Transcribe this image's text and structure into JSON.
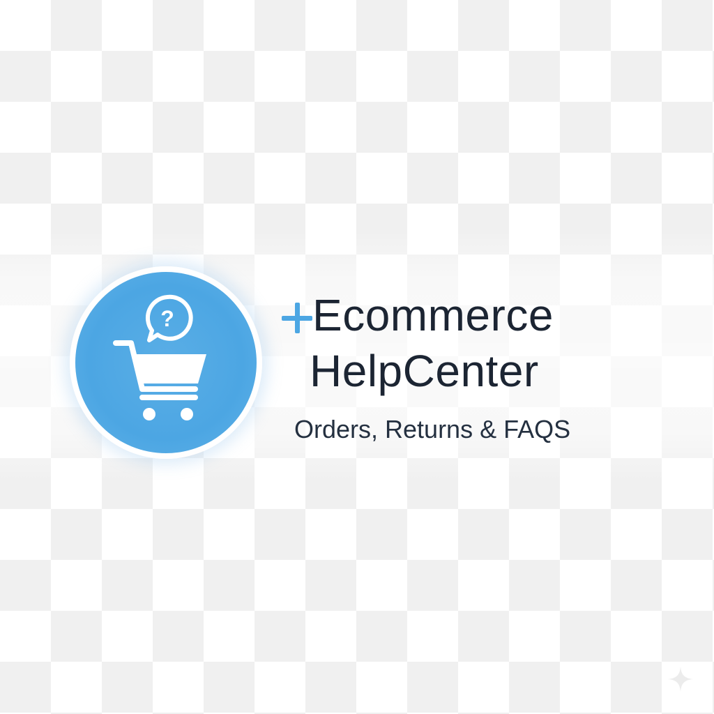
{
  "logo": {
    "icon": "shopping-cart-question-icon",
    "circle_color": "#4ca6e3"
  },
  "brand": {
    "plus_icon": "plus-icon",
    "title_line_1": "Ecommerce",
    "title_line_2": "HelpCenter",
    "tagline": "Orders, Returns & FAQS"
  },
  "colors": {
    "accent": "#4ca6e3",
    "text": "#1c2533"
  },
  "decor": {
    "corner_icon": "sparkle-icon"
  }
}
